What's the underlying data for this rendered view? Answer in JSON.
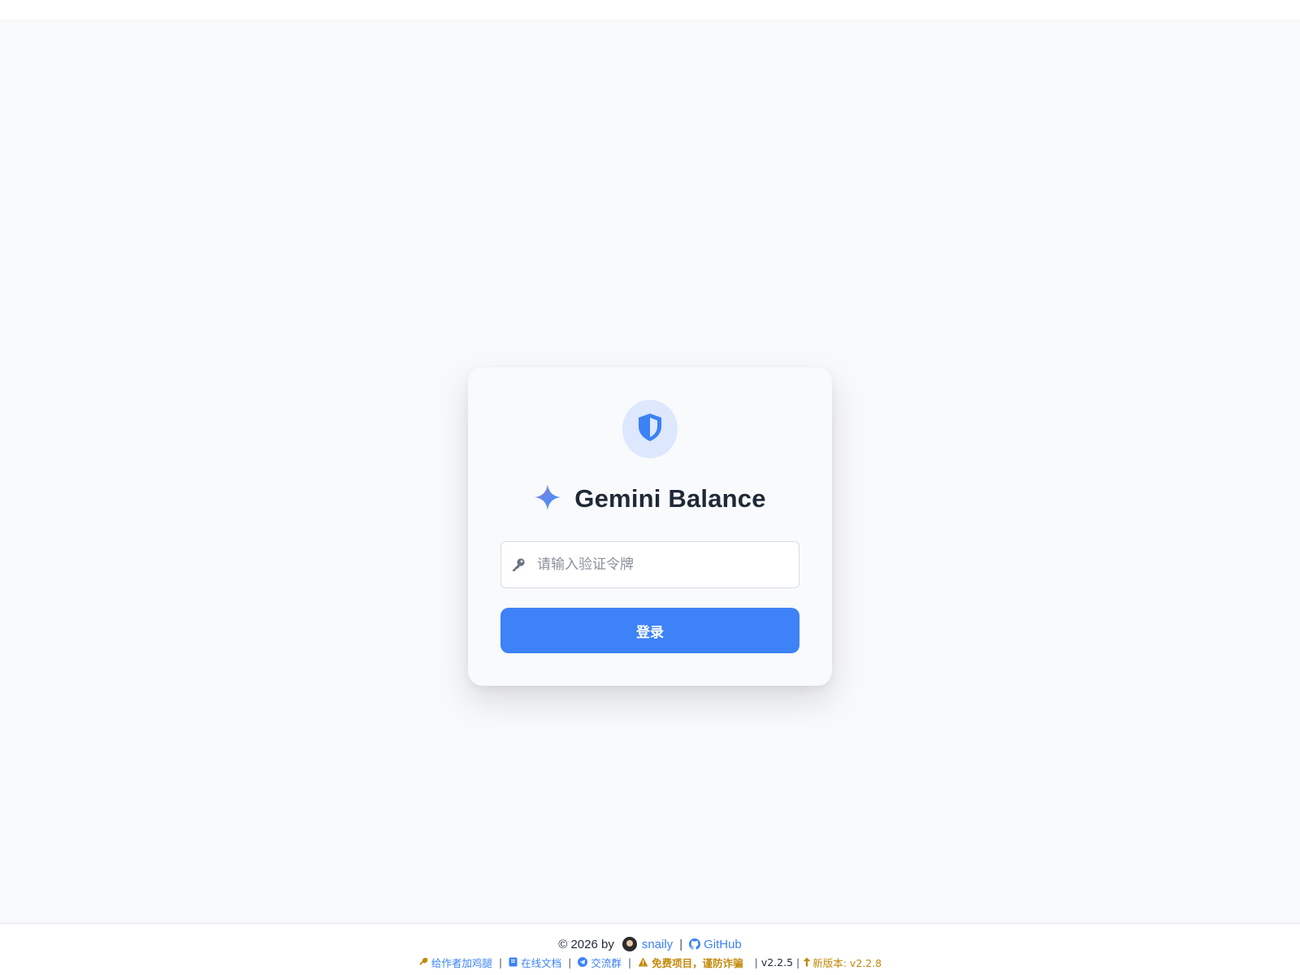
{
  "app": {
    "title": "Gemini Balance",
    "brand_colors": {
      "primary": "#3d82f6",
      "shield_bg": "#dde7fd",
      "warning": "#c2890b"
    },
    "icons": {
      "header": "shield-icon",
      "title": "sparkle-icon",
      "input": "key-icon"
    }
  },
  "login": {
    "token_placeholder": "请输入验证令牌",
    "token_value": "",
    "submit_label": "登录"
  },
  "footer": {
    "copyright": "© 2026 by",
    "author": "snaily",
    "github_label": "GitHub",
    "links": {
      "sponsor": "给作者加鸡腿",
      "docs": "在线文档",
      "group": "交流群",
      "warning": "免费项目，谨防诈骗"
    },
    "version": "v2.2.5",
    "new_version": "新版本: v2.2.8"
  }
}
